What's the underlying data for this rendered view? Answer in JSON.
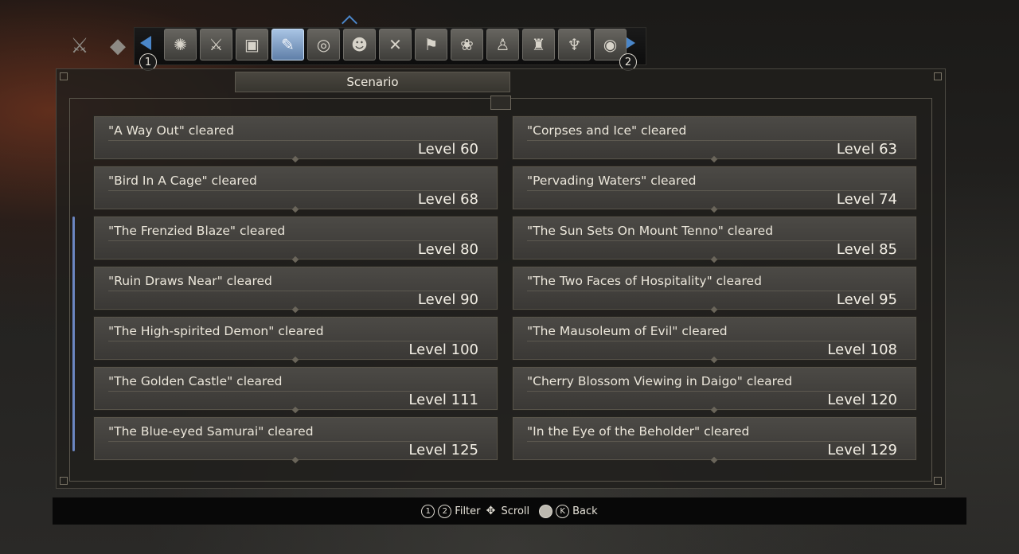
{
  "tabs": {
    "left_icon": "crossed-swords-icon",
    "left_icon2": "stone-icon",
    "prev_button": "1",
    "next_button": "2",
    "items": [
      {
        "icon": "flame-swirl-icon",
        "glyph": "✺",
        "active": false
      },
      {
        "icon": "warrior-icon",
        "glyph": "⚔",
        "active": false
      },
      {
        "icon": "chest-icon",
        "glyph": "▣",
        "active": false
      },
      {
        "icon": "scroll-icon",
        "glyph": "✎",
        "active": true
      },
      {
        "icon": "spiral-icon",
        "glyph": "◎",
        "active": false
      },
      {
        "icon": "demon-mask-icon",
        "glyph": "☻",
        "active": false
      },
      {
        "icon": "crossed-blades-icon",
        "glyph": "✕",
        "active": false
      },
      {
        "icon": "banner-icon",
        "glyph": "⚑",
        "active": false
      },
      {
        "icon": "whirlwind-icon",
        "glyph": "❀",
        "active": false
      },
      {
        "icon": "hooded-figure-icon",
        "glyph": "♙",
        "active": false
      },
      {
        "icon": "armor-icon",
        "glyph": "♜",
        "active": false
      },
      {
        "icon": "oni-icon",
        "glyph": "♆",
        "active": false
      },
      {
        "icon": "vortex-icon",
        "glyph": "◉",
        "active": false
      }
    ]
  },
  "panel": {
    "title": "Scenario"
  },
  "entries": [
    {
      "name": "\"A Way Out\" cleared",
      "level": "Level 60"
    },
    {
      "name": "\"Corpses and Ice\" cleared",
      "level": "Level 63"
    },
    {
      "name": "\"Bird In A Cage\" cleared",
      "level": "Level 68"
    },
    {
      "name": "\"Pervading Waters\" cleared",
      "level": "Level 74"
    },
    {
      "name": "\"The Frenzied Blaze\" cleared",
      "level": "Level 80"
    },
    {
      "name": "\"The Sun Sets On Mount Tenno\" cleared",
      "level": "Level 85"
    },
    {
      "name": "\"Ruin Draws Near\" cleared",
      "level": "Level 90"
    },
    {
      "name": "\"The Two Faces of Hospitality\" cleared",
      "level": "Level 95"
    },
    {
      "name": "\"The High-spirited Demon\" cleared",
      "level": "Level 100"
    },
    {
      "name": "\"The Mausoleum of Evil\" cleared",
      "level": "Level 108"
    },
    {
      "name": "\"The Golden Castle\" cleared",
      "level": "Level 111"
    },
    {
      "name": "\"Cherry Blossom Viewing in Daigo\" cleared",
      "level": "Level 120"
    },
    {
      "name": "\"The Blue-eyed Samurai\" cleared",
      "level": "Level 125"
    },
    {
      "name": "\"In the Eye of the Beholder\" cleared",
      "level": "Level 129"
    }
  ],
  "footer": {
    "btn1": "1",
    "btn2": "2",
    "filter": "Filter",
    "scroll": "Scroll",
    "btn_back_key": "K",
    "back": "Back"
  },
  "colors": {
    "accent": "#4a86c9",
    "active_tab": "#a9c4e4",
    "scrollbar": "#6b86c2"
  }
}
